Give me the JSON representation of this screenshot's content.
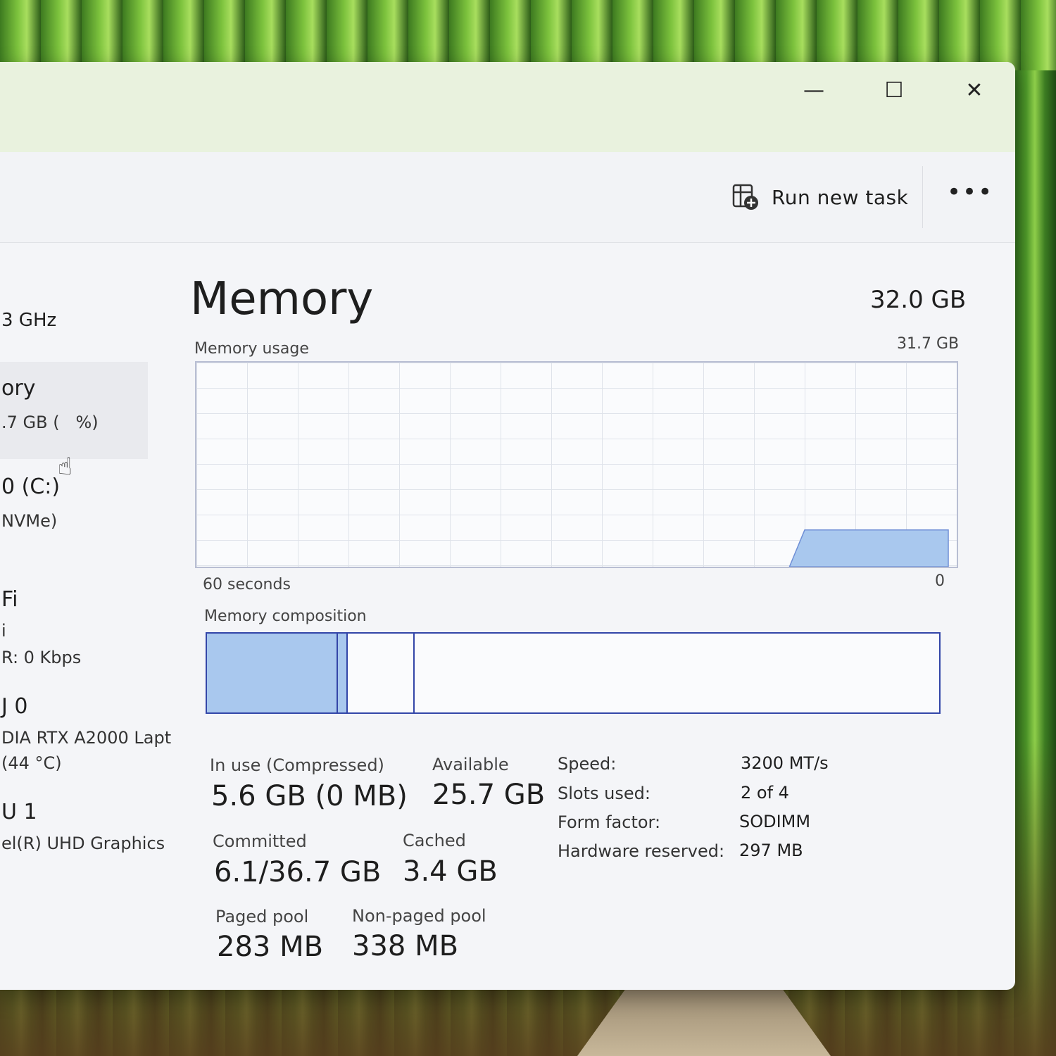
{
  "toolbar": {
    "run_new_task": "Run new task",
    "more": "•••"
  },
  "window_controls": {
    "minimize": "—",
    "maximize": "☐",
    "close": "✕"
  },
  "sidebar": {
    "cpu_sub": "3 GHz",
    "memory_main": "ory",
    "memory_sub": ".7 GB (",
    "memory_sub_end": "%)",
    "disk_main": "0 (C:)",
    "disk_sub": "NVMe)",
    "wifi_main": "Fi",
    "wifi_sub": "i",
    "wifi_sub2": "R: 0 Kbps",
    "gpu0_main": "J 0",
    "gpu0_sub": "DIA RTX A2000 Lapt",
    "gpu0_sub2": "(44 °C)",
    "gpu1_main": "U 1",
    "gpu1_sub": "el(R) UHD Graphics"
  },
  "main": {
    "title": "Memory",
    "total": "32.0 GB",
    "usage_label": "Memory usage",
    "usage_max": "31.7 GB",
    "time_left": "60 seconds",
    "time_right": "0",
    "composition_label": "Memory composition"
  },
  "composition": {
    "in_use_fraction": 0.18,
    "modified_fraction": 0.013,
    "standby_fraction": 0.092,
    "free_fraction": 0.715,
    "in_use_color": "#a9c8ee",
    "border_color": "#3346a8"
  },
  "usage_graph": {
    "current_fraction": 0.18,
    "fill_color": "#a9c8ee"
  },
  "stats": {
    "in_use_label": "In use (Compressed)",
    "in_use_value": "5.6 GB (0 MB)",
    "available_label": "Available",
    "available_value": "25.7 GB",
    "committed_label": "Committed",
    "committed_value": "6.1/36.7 GB",
    "cached_label": "Cached",
    "cached_value": "3.4 GB",
    "paged_label": "Paged pool",
    "paged_value": "283 MB",
    "nonpaged_label": "Non-paged pool",
    "nonpaged_value": "338 MB"
  },
  "specs": {
    "speed_label": "Speed:",
    "speed_value": "3200 MT/s",
    "slots_label": "Slots used:",
    "slots_value": "2 of 4",
    "form_label": "Form factor:",
    "form_value": "SODIMM",
    "hw_label": "Hardware reserved:",
    "hw_value": "297 MB"
  }
}
